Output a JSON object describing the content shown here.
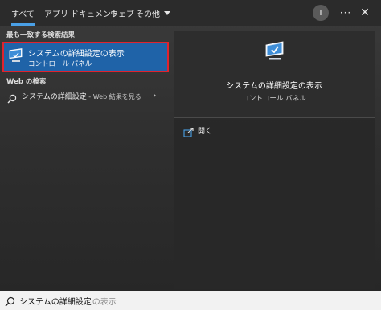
{
  "topbar": {
    "tabs": [
      {
        "label": "すべて",
        "active": true
      },
      {
        "label": "アプリ",
        "active": false
      },
      {
        "label": "ドキュメント",
        "active": false
      },
      {
        "label": "ウェブ",
        "active": false
      },
      {
        "label": "その他",
        "active": false
      }
    ],
    "avatar_initial": "I",
    "more_icon": "ellipsis-icon",
    "close_icon": "close-icon"
  },
  "left": {
    "best_match_header": "最も一致する検索結果",
    "best_match": {
      "title": "システムの詳細設定の表示",
      "subtitle": "コントロール パネル",
      "icon": "monitor-check-icon"
    },
    "web_header": "Web の検索",
    "web_result": {
      "query": "システムの詳細設定",
      "suffix": " - Web 結果を見る",
      "icon": "search-icon",
      "arrow_icon": "chevron-right-icon"
    }
  },
  "preview": {
    "title": "システムの詳細設定の表示",
    "subtitle": "コントロール パネル",
    "icon": "monitor-check-icon",
    "actions": [
      {
        "label": "開く",
        "icon": "open-window-icon"
      }
    ]
  },
  "search": {
    "typed": "システムの詳細設定",
    "hint": "の表示",
    "icon": "search-icon"
  },
  "colors": {
    "accent": "#4aa0e6",
    "selection": "#1f63a8",
    "highlight_border": "#e0232e"
  }
}
